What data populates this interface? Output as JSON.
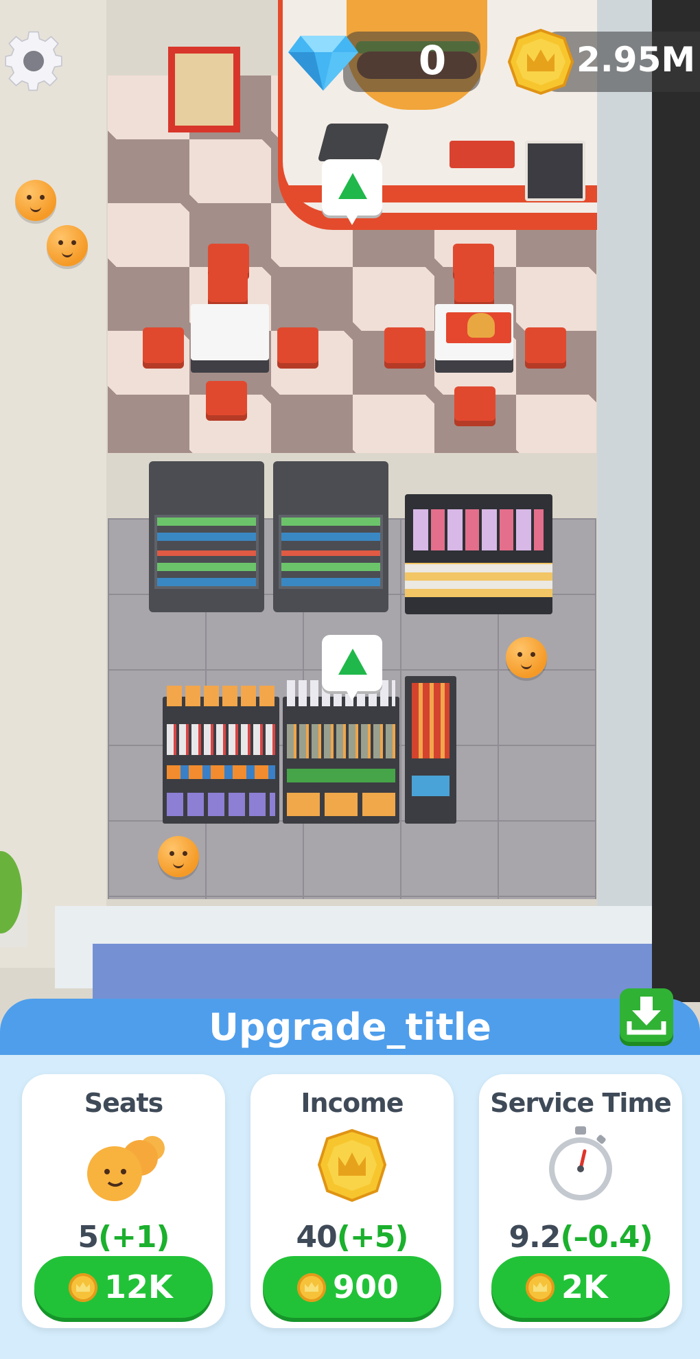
{
  "hud": {
    "gems": "0",
    "coins": "2.95M",
    "settings_icon": "gear-icon",
    "gem_icon": "diamond-icon",
    "coin_icon": "crown-coin-icon"
  },
  "upgrade_panel": {
    "title": "Upgrade_title",
    "collapse_icon": "download-arrow-icon",
    "cards": [
      {
        "title": "Seats",
        "value": "5",
        "delta": "(+1)",
        "price": "12K",
        "icon": "customer-faces-icon"
      },
      {
        "title": "Income",
        "value": "40",
        "delta": "(+5)",
        "price": "900",
        "icon": "crown-coin-icon"
      },
      {
        "title": "Service Time",
        "value": "9.2",
        "delta": "(–0.4)",
        "price": "2K",
        "icon": "stopwatch-icon"
      }
    ]
  },
  "colors": {
    "accent_green": "#22c238",
    "panel_header_blue": "#4f9eeb",
    "panel_bg": "#d4ecfb",
    "delta_green": "#1bb02d"
  }
}
